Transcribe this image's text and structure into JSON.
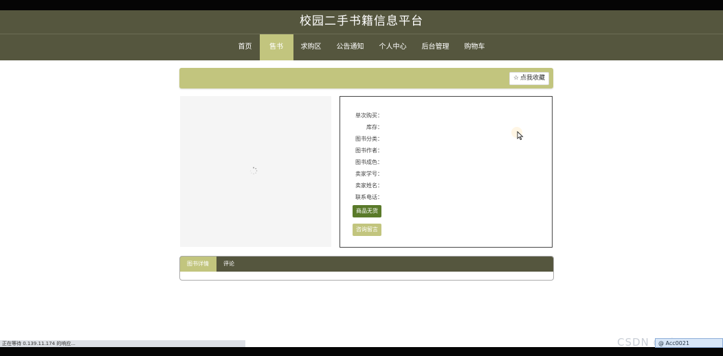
{
  "header": {
    "title": "校园二手书籍信息平台"
  },
  "nav": {
    "items": [
      "首页",
      "售书区",
      "求购区",
      "公告通知",
      "个人中心",
      "后台管理",
      "购物车"
    ],
    "active_index": 1
  },
  "favorite": {
    "icon": "star-outline-icon",
    "label": "点我收藏"
  },
  "details": {
    "rows": [
      "单次购买：",
      "库存：",
      "图书分类：",
      "图书作者：",
      "图书成色：",
      "卖家学号：",
      "卖家姓名：",
      "联系电话："
    ],
    "sold_out_label": "商品无货",
    "message_label": "咨询留言"
  },
  "tabs": {
    "items": [
      "图书详情",
      "评论"
    ]
  },
  "browser": {
    "status_text": "正在等待 0.139.11.174 的响应..."
  },
  "overlay": {
    "watermark": "CSDN @ck0021",
    "tray_text": "@ Acc0021"
  },
  "colors": {
    "header": "#55563e",
    "accent": "#c2c57e",
    "green_button": "#5a7a2a"
  }
}
